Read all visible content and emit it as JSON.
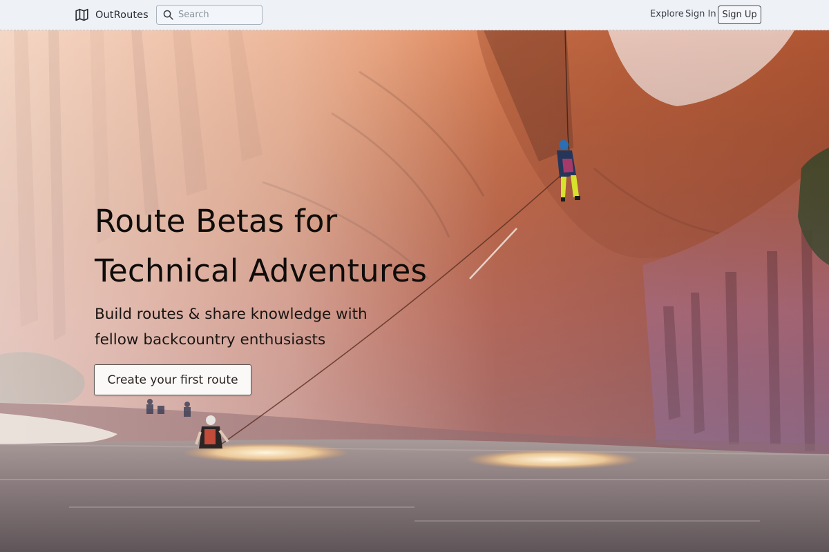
{
  "header": {
    "brand_name": "OutRoutes",
    "brand_icon": "map-icon",
    "search": {
      "placeholder": "Search",
      "value": "",
      "icon": "search-icon"
    },
    "nav": {
      "explore": "Explore",
      "sign_in": "Sign In",
      "sign_up": "Sign Up"
    }
  },
  "hero": {
    "headline_line1": "Route Betas for",
    "headline_line2": "Technical Adventures",
    "subtitle_line1": "Build routes & share knowledge with",
    "subtitle_line2": "fellow backcountry enthusiasts",
    "cta_label": "Create your first route"
  },
  "colors": {
    "header_bg": "#eef2f7",
    "text_dark": "#0f0c0a",
    "canyon_orange": "#d9794a",
    "canyon_pink": "#c98a9b",
    "water": "#6e6468"
  }
}
